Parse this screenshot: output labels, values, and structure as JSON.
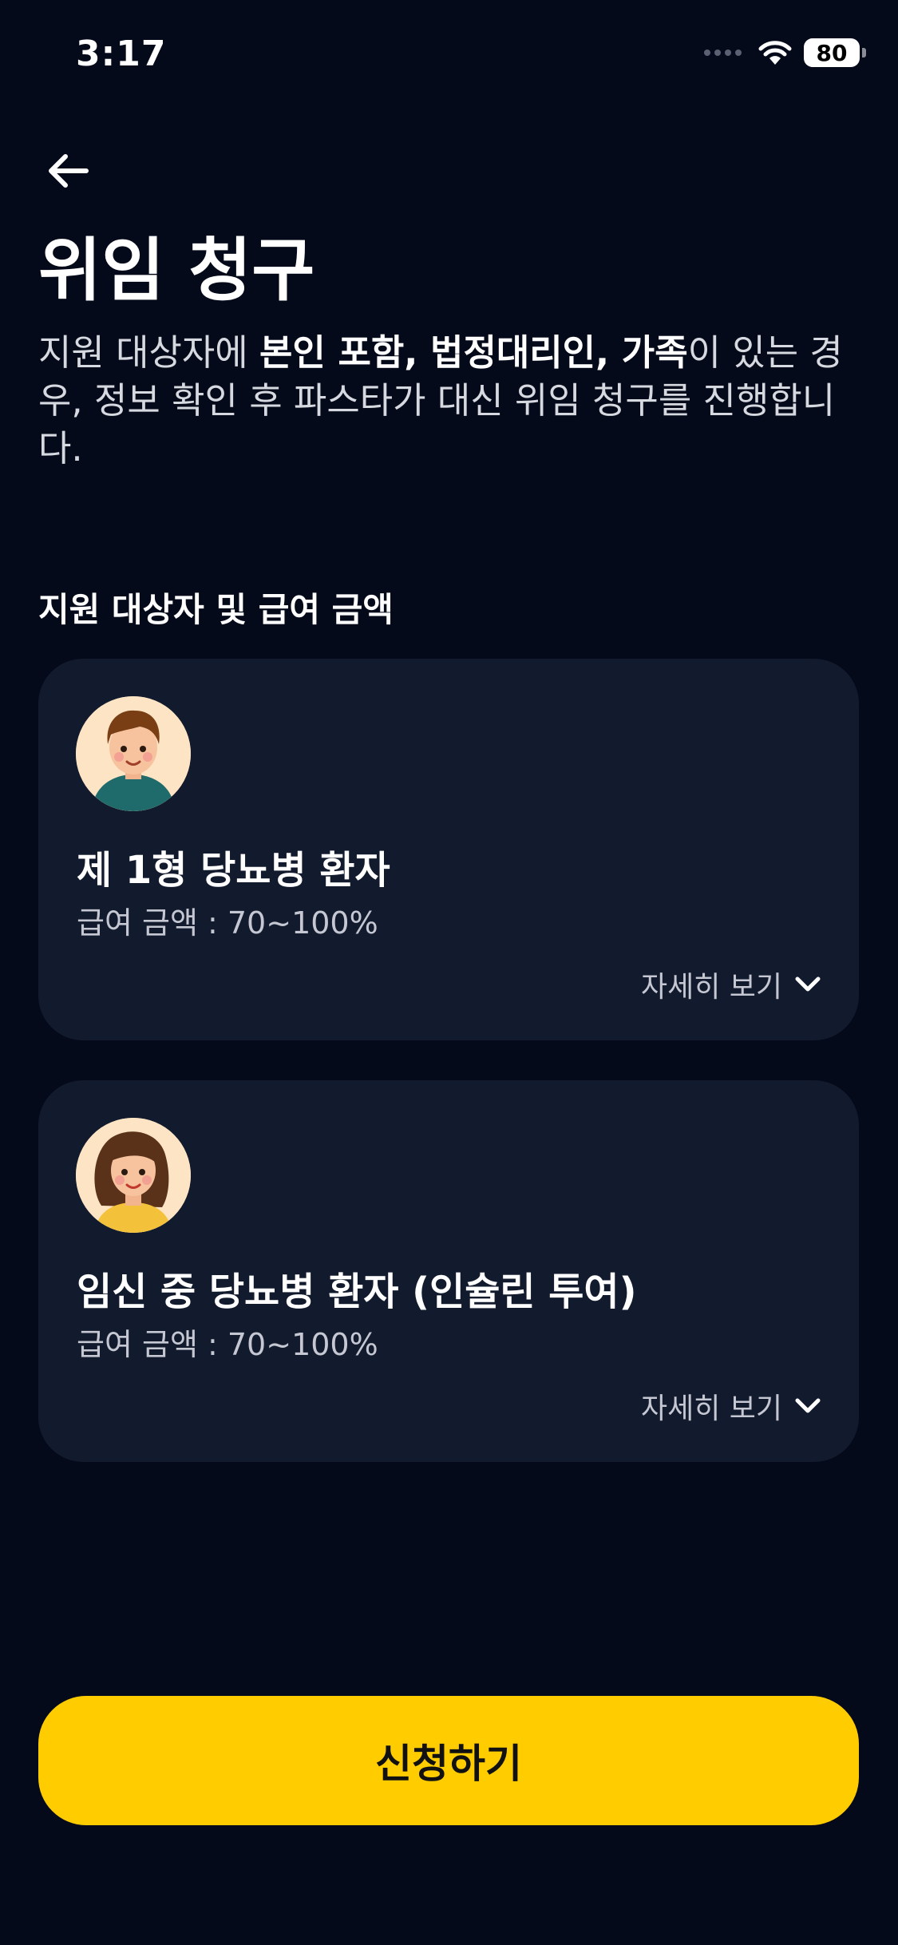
{
  "status_bar": {
    "time": "3:17",
    "battery": "80"
  },
  "header": {
    "back_icon": "arrow-left-icon"
  },
  "page": {
    "title": "위임 청구",
    "description": {
      "part1": "지원 대상자에 ",
      "bold1": "본인 포함, 법정대리인, 가족",
      "part2": "이 있는 경우, 정보 확인 후 파스타가 대신 위임 청구를 진행합니다."
    }
  },
  "section": {
    "title": "지원 대상자 및 급여 금액"
  },
  "cards": [
    {
      "avatar": "male-avatar",
      "title": "제 1형 당뇨병 환자",
      "amount": "급여 금액 : 70~100%",
      "detail_label": "자세히 보기",
      "detail_icon": "chevron-down-icon"
    },
    {
      "avatar": "female-avatar",
      "title": "임신 중 당뇨병 환자 (인슐린 투여)",
      "amount": "급여 금액 : 70~100%",
      "detail_label": "자세히 보기",
      "detail_icon": "chevron-down-icon"
    }
  ],
  "cta": {
    "label": "신청하기"
  },
  "colors": {
    "background": "#050a1a",
    "card": "#121a2d",
    "accent": "#ffcc00"
  }
}
